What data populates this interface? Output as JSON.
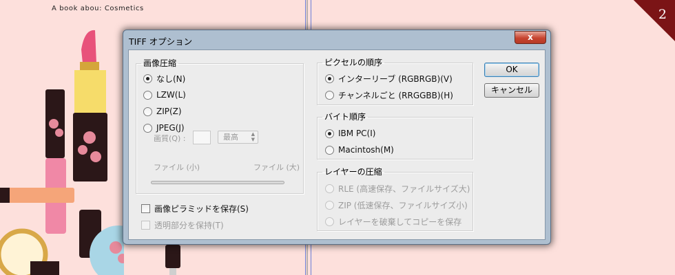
{
  "document": {
    "header": "A  book abou: Cosmetics",
    "page_number": "2"
  },
  "dialog": {
    "title": "TIFF オプション",
    "close_label": "x",
    "buttons": {
      "ok": "OK",
      "cancel": "キャンセル"
    },
    "image_compression": {
      "legend": "画像圧縮",
      "options": [
        {
          "label": "なし(N)",
          "checked": true
        },
        {
          "label": "LZW(L)",
          "checked": false
        },
        {
          "label": "ZIP(Z)",
          "checked": false
        },
        {
          "label": "JPEG(J)",
          "checked": false
        }
      ],
      "quality_label": "画質(Q) :",
      "quality_select": "最高",
      "file_small": "ファイル (小)",
      "file_large": "ファイル (大)"
    },
    "save_pyramid": {
      "label": "画像ピラミッドを保存(S)",
      "checked": false
    },
    "save_transparency": {
      "label": "透明部分を保持(T)",
      "checked": false
    },
    "pixel_order": {
      "legend": "ピクセルの順序",
      "options": [
        {
          "label": "インターリーブ (RGBRGB)(V)",
          "checked": true
        },
        {
          "label": "チャンネルごと (RRGGBB)(H)",
          "checked": false
        }
      ]
    },
    "byte_order": {
      "legend": "バイト順序",
      "options": [
        {
          "label": "IBM PC(I)",
          "checked": true
        },
        {
          "label": "Macintosh(M)",
          "checked": false
        }
      ]
    },
    "layer_compression": {
      "legend": "レイヤーの圧縮",
      "options": [
        {
          "label": "RLE (高速保存、ファイルサイズ大)",
          "checked": false
        },
        {
          "label": "ZIP (低速保存、ファイルサイズ小)",
          "checked": false
        },
        {
          "label": "レイヤーを破棄してコピーを保存",
          "checked": false
        }
      ]
    }
  },
  "colors": {
    "background": "#fde0dc",
    "dialog_frame": "#aebfd0",
    "badge": "#7b1416"
  }
}
